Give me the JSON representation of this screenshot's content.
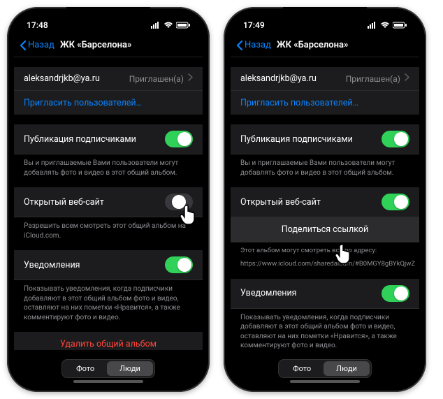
{
  "colors": {
    "accent": "#0a84ff",
    "green": "#30d158",
    "red": "#ff453a",
    "gray": "#8e8e93"
  },
  "left": {
    "time": "17:48",
    "back": "Назад",
    "title": "ЖК «Барселона»",
    "invitee_email": "aleksandrjkb@ya.ru",
    "invitee_status": "Приглашен(а)",
    "invite_more": "Пригласить пользователей…",
    "subscriber_posting": {
      "label": "Публикация подписчиками",
      "on": true
    },
    "subscriber_footer": "Вы и приглашаемые Вами пользователи могут добавлять фото и видео в этот общий альбом.",
    "public_site": {
      "label": "Открытый веб-сайт",
      "on": false
    },
    "public_footer": "Разрешить всем смотреть этот общий альбом на iCloud.com.",
    "notifications": {
      "label": "Уведомления",
      "on": true
    },
    "notifications_footer": "Показывать уведомления, когда подписчики добавляют в этот общий альбом фото и видео, оставляют на них пометки «Нравится», а также комментируют фото и видео.",
    "delete": "Удалить общий альбом",
    "tabs": {
      "photo": "Фото",
      "people": "Люди",
      "active": "people"
    }
  },
  "right": {
    "time": "17:49",
    "back": "Назад",
    "title": "ЖК «Барселона»",
    "invitee_email": "aleksandrjkb@ya.ru",
    "invitee_status": "Приглашен(а)",
    "invite_more": "Пригласить пользователей…",
    "subscriber_posting": {
      "label": "Публикация подписчиками",
      "on": true
    },
    "subscriber_footer": "Вы и приглашаемые Вами пользователи могут добавлять фото и видео в этот общий альбом.",
    "public_site": {
      "label": "Открытый веб-сайт",
      "on": true
    },
    "share_link": "Поделиться ссылкой",
    "public_footer_lead": "Этот альбом могут смотреть все по адресу:",
    "public_url": "https://www.icloud.com/sharedalbum/#B0MGY8gBYkQjwZ",
    "notifications": {
      "label": "Уведомления",
      "on": true
    },
    "notifications_footer": "Показывать уведомления, когда подписчики добавляют в этот общий альбом фото и видео, оставляют на них пометки «Нравится», а также комментируют фото и видео.",
    "tabs": {
      "photo": "Фото",
      "people": "Люди",
      "active": "people"
    }
  }
}
